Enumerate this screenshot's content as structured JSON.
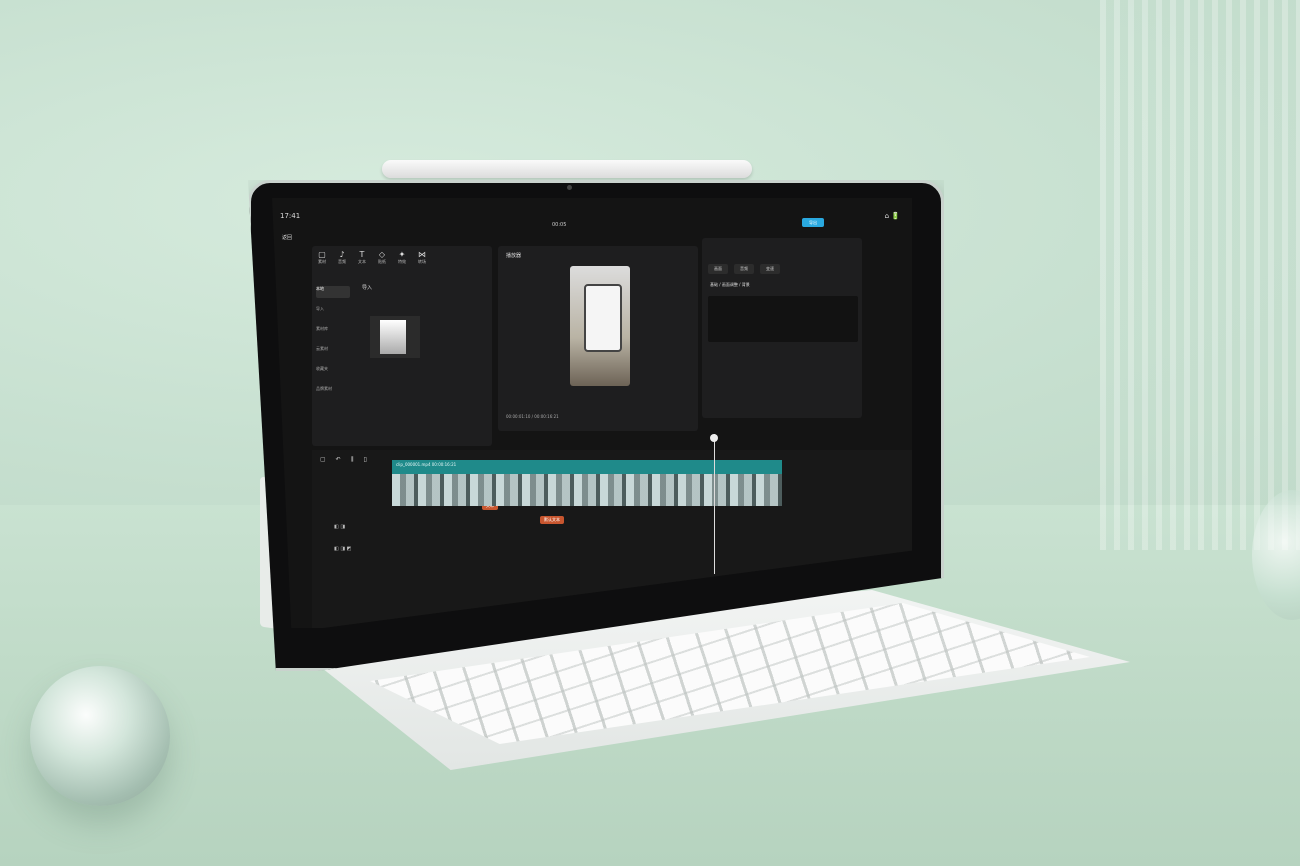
{
  "screen": {
    "time": "17:41",
    "status_icons": "⌂ 🔋",
    "project_title": "00:05",
    "export_label": "导出",
    "back_label": "返回"
  },
  "media_panel": {
    "tools": [
      {
        "label": "素材",
        "icon": "▢"
      },
      {
        "label": "音频",
        "icon": "♪"
      },
      {
        "label": "文本",
        "icon": "T"
      },
      {
        "label": "贴纸",
        "icon": "◇"
      },
      {
        "label": "特效",
        "icon": "✦"
      },
      {
        "label": "转场",
        "icon": "⋈"
      }
    ],
    "side_menu": [
      "本地",
      "导入",
      "素材库",
      "云素材",
      "收藏夹",
      "品牌素材"
    ],
    "import_label": "导入"
  },
  "preview_panel": {
    "title": "播放器",
    "timecode": "00:00:01:10 / 00:00:16:21"
  },
  "property_panel": {
    "tabs": [
      "画面",
      "音频",
      "变速"
    ],
    "text": "基础 / 画面调整 / 背景"
  },
  "timeline": {
    "video_clip_label": "clip_000001.mp4  00:00:16:21",
    "text_clips": [
      "文本",
      "默认文本",
      "标记"
    ]
  }
}
